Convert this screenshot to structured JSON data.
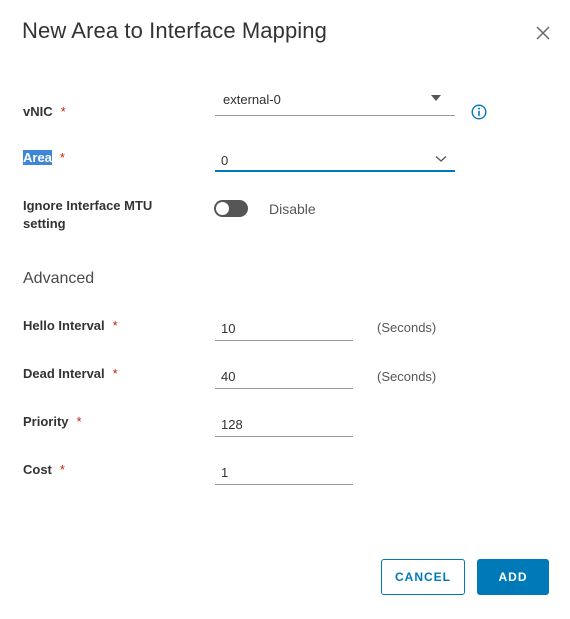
{
  "dialog": {
    "title": "New Area to Interface Mapping",
    "close_icon": "close-icon"
  },
  "form": {
    "required_marker": "*",
    "vnic": {
      "label": "vNIC",
      "value": "external-0",
      "icon": "info-icon"
    },
    "area": {
      "label": "Area",
      "value": "0"
    },
    "ignore_mtu": {
      "label_line1": "Ignore Interface MTU",
      "label_line2": "setting",
      "state_text": "Disable",
      "enabled": false
    },
    "advanced": {
      "heading": "Advanced",
      "hello_interval": {
        "label": "Hello Interval",
        "value": "10",
        "unit": "(Seconds)"
      },
      "dead_interval": {
        "label": "Dead Interval",
        "value": "40",
        "unit": "(Seconds)"
      },
      "priority": {
        "label": "Priority",
        "value": "128"
      },
      "cost": {
        "label": "Cost",
        "value": "1"
      }
    }
  },
  "buttons": {
    "cancel": "CANCEL",
    "add": "ADD"
  },
  "colors": {
    "accent": "#0079b8",
    "required": "#c92100",
    "toggle_off": "#565656",
    "selection": "#3d87d6"
  }
}
